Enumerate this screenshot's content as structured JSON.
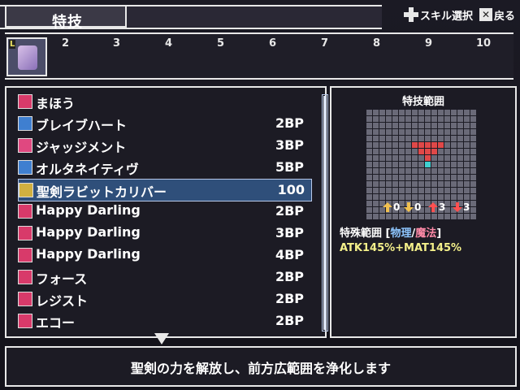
{
  "header": {
    "title": "特技"
  },
  "help": {
    "dpad_label": "スキル選択",
    "back_label": "戻る",
    "back_key": "✕"
  },
  "party": {
    "lv_label": "L",
    "slots": [
      "2",
      "3",
      "4",
      "5",
      "6",
      "7",
      "8",
      "9",
      "10"
    ]
  },
  "skills": [
    {
      "name": "まほう",
      "cost": "",
      "icon_color": "#e8e8e8",
      "icon_bg": "#d83a6a"
    },
    {
      "name": "ブレイブハート",
      "cost": "2BP",
      "icon_color": "#e8e8e8",
      "icon_bg": "#3f7fd0"
    },
    {
      "name": "ジャッジメント",
      "cost": "3BP",
      "icon_color": "#e8e8e8",
      "icon_bg": "#e04880"
    },
    {
      "name": "オルタネイティヴ",
      "cost": "5BP",
      "icon_color": "#e8e8e8",
      "icon_bg": "#3f7fd0"
    },
    {
      "name": "聖剣ラビットカリバー",
      "cost": "100",
      "icon_color": "#e8e8e8",
      "icon_bg": "#d0b040",
      "selected": true
    },
    {
      "name": "Happy Darling",
      "cost": "2BP",
      "icon_color": "#e8e8e8",
      "icon_bg": "#d83a6a"
    },
    {
      "name": "Happy Darling",
      "cost": "3BP",
      "icon_color": "#e8e8e8",
      "icon_bg": "#d83a6a"
    },
    {
      "name": "Happy Darling",
      "cost": "4BP",
      "icon_color": "#e8e8e8",
      "icon_bg": "#d83a6a"
    },
    {
      "name": "フォース",
      "cost": "2BP",
      "icon_color": "#e8e8e8",
      "icon_bg": "#d83a6a"
    },
    {
      "name": "レジスト",
      "cost": "2BP",
      "icon_color": "#e8e8e8",
      "icon_bg": "#d83a6a"
    },
    {
      "name": "エコー",
      "cost": "2BP",
      "icon_color": "#e8e8e8",
      "icon_bg": "#d83a6a"
    }
  ],
  "range": {
    "title": "特技範囲",
    "grid_cols": 17,
    "grid_rows": 17,
    "red_cells": [
      [
        7,
        5
      ],
      [
        8,
        5
      ],
      [
        9,
        5
      ],
      [
        10,
        5
      ],
      [
        11,
        5
      ],
      [
        8,
        6
      ],
      [
        9,
        6
      ],
      [
        10,
        6
      ],
      [
        9,
        7
      ]
    ],
    "player_cell": [
      9,
      8
    ],
    "stats": [
      {
        "label": "0",
        "color": "#f0c050"
      },
      {
        "label": "0",
        "color": "#f0c050"
      },
      {
        "label": "3",
        "color": "#ff5050"
      },
      {
        "label": "3",
        "color": "#ff5050"
      }
    ],
    "type_label": "特殊範囲",
    "type_open": "[",
    "phys": "物理",
    "slash": "/",
    "mag": "魔法",
    "type_close": "]",
    "atk": "ATK145%+MAT145%"
  },
  "description": "聖剣の力を解放し、前方広範囲を浄化します"
}
